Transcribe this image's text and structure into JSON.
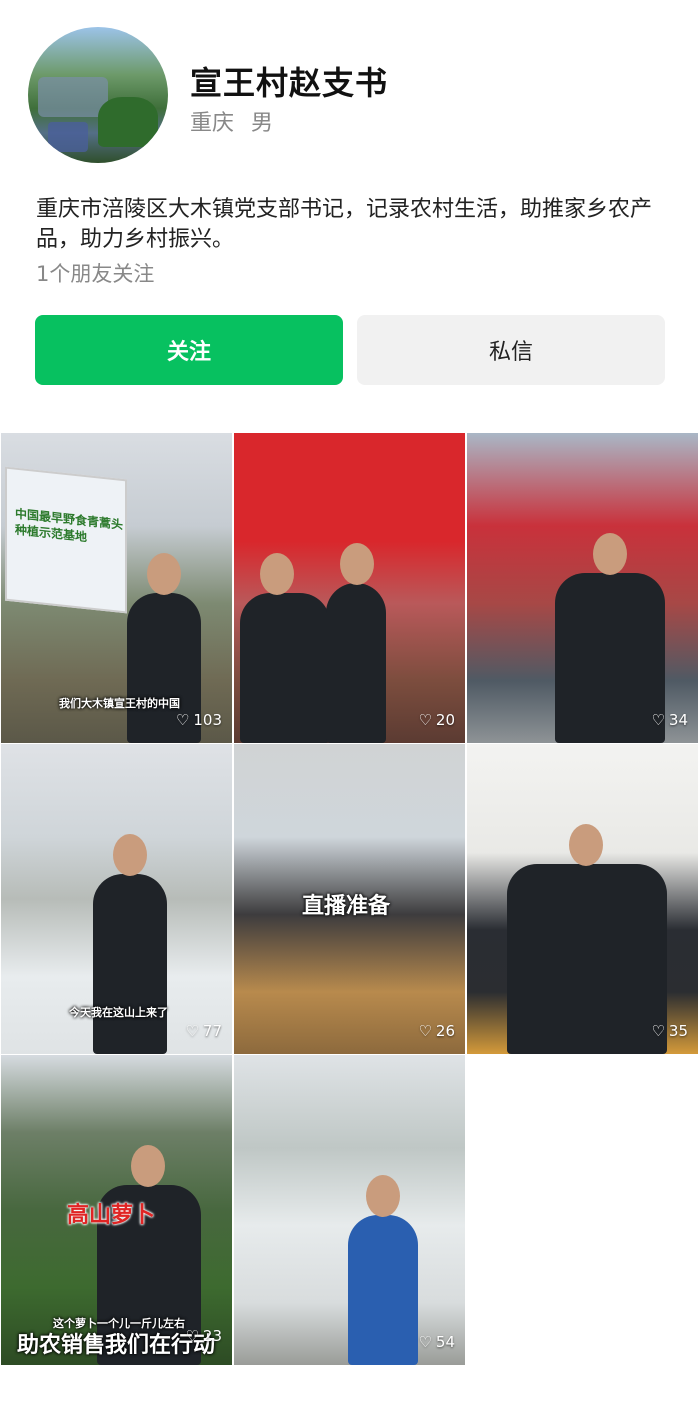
{
  "profile": {
    "name": "宣王村赵支书",
    "location": "重庆",
    "gender": "男",
    "bio": "重庆市涪陵区大木镇党支部书记，记录农村生活，助推家乡农产品，助力乡村振兴。",
    "friends_following": "1个朋友关注"
  },
  "actions": {
    "follow_label": "关注",
    "message_label": "私信"
  },
  "colors": {
    "follow_bg": "#07c160",
    "message_bg": "#f1f1f1"
  },
  "videos": [
    {
      "likes": "103",
      "caption": "我们大木镇宣王村的中国",
      "sign_text": "中国最早野食青蒿头种植示范基地"
    },
    {
      "likes": "20"
    },
    {
      "likes": "34"
    },
    {
      "likes": "77",
      "caption": "今天我在这山上来了"
    },
    {
      "likes": "26",
      "title_overlay": "直播准备"
    },
    {
      "likes": "35"
    },
    {
      "likes": "23",
      "title_overlay": "高山萝卜",
      "caption": "这个萝卜一个儿一斤儿左右",
      "bottom_overlay": "助农销售我们在行动"
    },
    {
      "likes": "54"
    }
  ]
}
